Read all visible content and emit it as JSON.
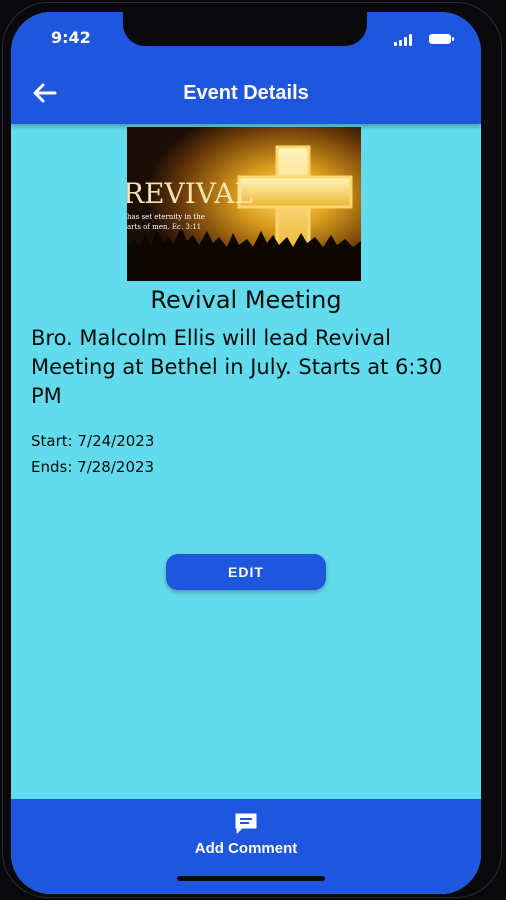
{
  "status_bar": {
    "time": "9:42"
  },
  "app_bar": {
    "title": "Event Details",
    "back_icon": "arrow-left-icon"
  },
  "event": {
    "image_text": {
      "title": "REVIVAL",
      "verse_line1": "has set eternity in the",
      "verse_line2": "arts of men. Ec. 3:11"
    },
    "name": "Revival Meeting",
    "description": "Bro. Malcolm Ellis will lead Revival Meeting at Bethel in July. Starts at 6:30 PM",
    "start_label": "Start:",
    "start_date": "7/24/2023",
    "end_label": "Ends:",
    "end_date": "7/28/2023"
  },
  "actions": {
    "edit_label": "EDIT"
  },
  "bottom_bar": {
    "add_comment_label": "Add Comment",
    "icon": "comment-icon"
  },
  "colors": {
    "primary": "#1e56de",
    "background": "#62dcec"
  }
}
